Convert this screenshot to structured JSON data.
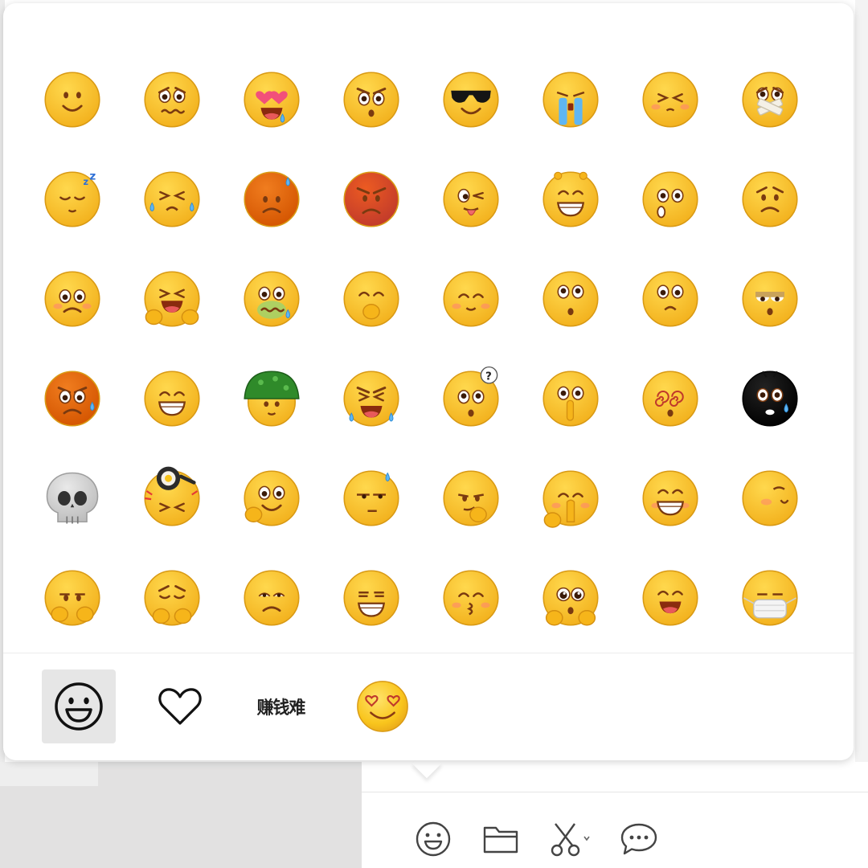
{
  "emoji_picker": {
    "emojis": [
      "smile-emoji",
      "awkward-emoji",
      "heart-eyes-drool-emoji",
      "stunned-emoji",
      "cool-sunglasses-emoji",
      "crying-emoji",
      "shy-emoji",
      "shut-mouth-emoji",
      "sleepy-emoji",
      "tearful-squint-emoji",
      "blushing-sweat-emoji",
      "angry-emoji",
      "tongue-wink-emoji",
      "big-grin-emoji",
      "surprised-emoji",
      "frown-emoji",
      "pitiful-emoji",
      "laughing-tears-emoji",
      "sick-emoji",
      "giggle-emoji",
      "content-smile-emoji",
      "shocked-emoji",
      "doubtful-emoji",
      "sleepy-eyes-emoji",
      "mad-sweat-emoji",
      "beaming-emoji",
      "helmet-emoji",
      "furious-tears-emoji",
      "question-emoji",
      "shush-emoji",
      "dizzy-emoji",
      "black-scared-emoji",
      "skull-emoji",
      "frying-pan-emoji",
      "face-palm-smile-emoji",
      "sweat-meh-emoji",
      "smirk-emoji",
      "pray-emoji",
      "grin-teeth-emoji",
      "side-smile-emoji",
      "fist-emoji",
      "wrongful-emoji",
      "sad-brows-emoji",
      "grimace-emoji",
      "kiss-emoji",
      "puppy-eyes-emoji",
      "laugh-emoji",
      "mask-emoji"
    ]
  },
  "tabs": {
    "default_icon": "smile-face-icon",
    "favorites_icon": "heart-icon",
    "sticker_text": "赚钱难",
    "sticker_icon": "heart-eyes-smile-icon"
  },
  "toolbar": {
    "icons": [
      "emoji-icon",
      "folder-icon",
      "scissors-icon",
      "chat-bubble-icon"
    ]
  },
  "colors": {
    "emoji_yellow": "#f9c51d",
    "emoji_orange": "#f07d1f",
    "active_tab_bg": "#e6e6e6",
    "icon_stroke": "#333333"
  }
}
